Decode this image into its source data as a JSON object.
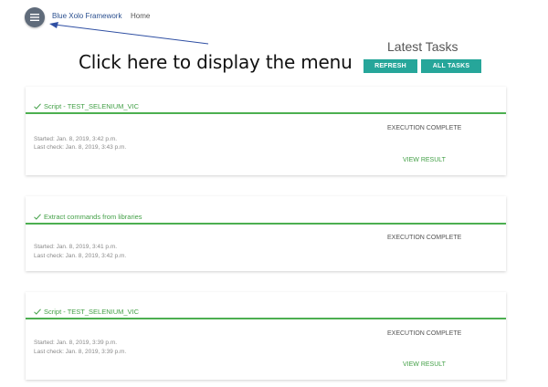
{
  "header": {
    "menu_icon": "hamburger-menu-icon",
    "brand": "Blue Xolo Framework",
    "home": "Home"
  },
  "annotation": {
    "text": "Click here to display the menu"
  },
  "tasks_panel": {
    "title": "Latest Tasks",
    "refresh_label": "REFRESH",
    "all_tasks_label": "ALL TASKS"
  },
  "colors": {
    "accent": "#26a69a",
    "success": "#43a047",
    "menu_button": "#5f6b7a",
    "arrow": "#2f4fa3"
  },
  "tasks": [
    {
      "icon": "check-icon",
      "title": "Script - TEST_SELENIUM_VIC",
      "status": "EXECUTION COMPLETE",
      "started": "Started: Jan. 8, 2019, 3:42 p.m.",
      "last_check": "Last check: Jan. 8, 2019, 3:43 p.m.",
      "action": "VIEW RESULT"
    },
    {
      "icon": "check-icon",
      "title": "Extract commands from libraries",
      "status": "EXECUTION COMPLETE",
      "started": "Started: Jan. 8, 2019, 3:41 p.m.",
      "last_check": "Last check: Jan. 8, 2019, 3:42 p.m."
    },
    {
      "icon": "check-icon",
      "title": "Script - TEST_SELENIUM_VIC",
      "status": "EXECUTION COMPLETE",
      "started": "Started: Jan. 8, 2019, 3:39 p.m.",
      "last_check": "Last check: Jan. 8, 2019, 3:39 p.m.",
      "action": "VIEW RESULT"
    }
  ]
}
